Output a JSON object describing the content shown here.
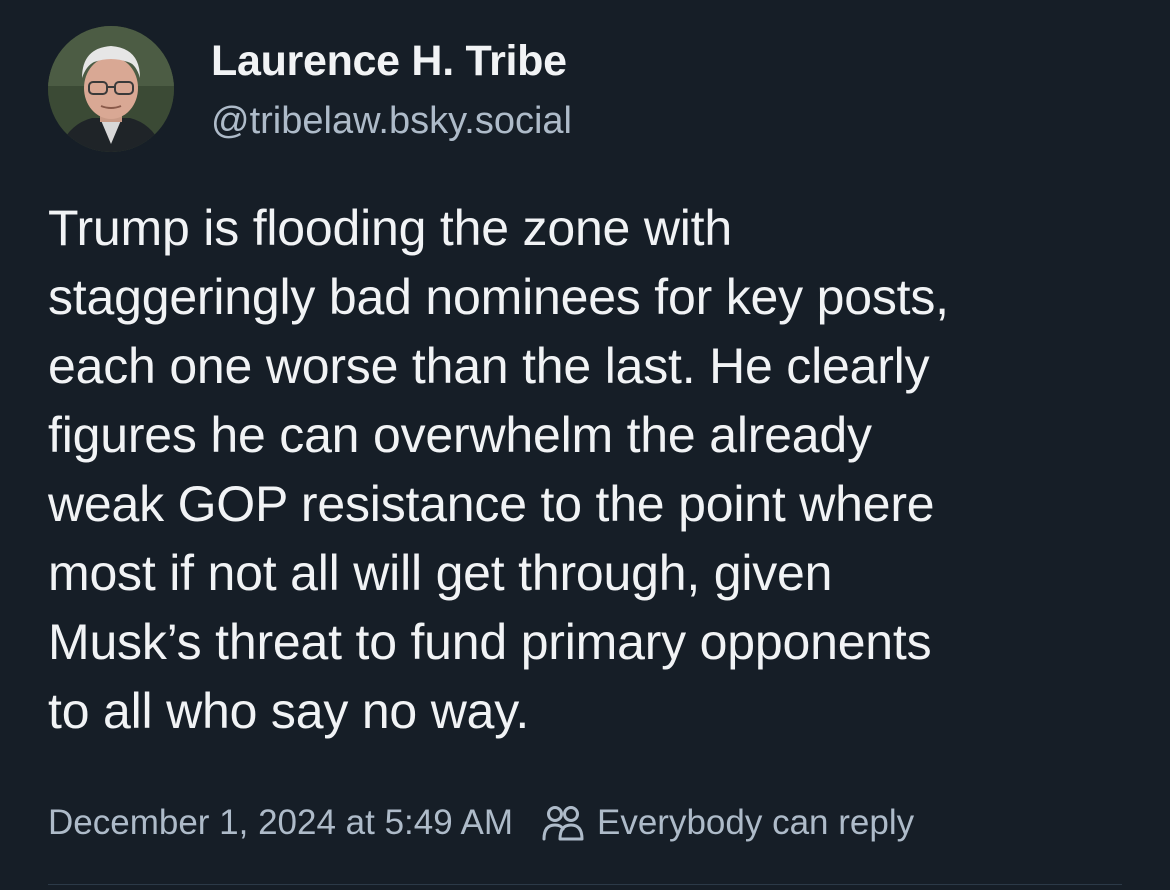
{
  "post": {
    "author": {
      "display_name": "Laurence H. Tribe",
      "handle": "@tribelaw.bsky.social"
    },
    "text": "Trump is flooding the zone with\nstaggeringly bad nominees for key posts,\neach one worse than the last. He clearly\nfigures he can overwhelm the already\nweak GOP resistance to the point where\nmost if not all will get through, given\nMusk’s threat to fund primary opponents\nto all who say no way.",
    "timestamp": "December 1, 2024 at 5:49 AM",
    "reply_setting": "Everybody can reply",
    "reply_setting_icon": "people-icon"
  },
  "colors": {
    "background": "#161e27",
    "text_primary": "#f1f3f5",
    "text_secondary": "#aebbc9"
  }
}
